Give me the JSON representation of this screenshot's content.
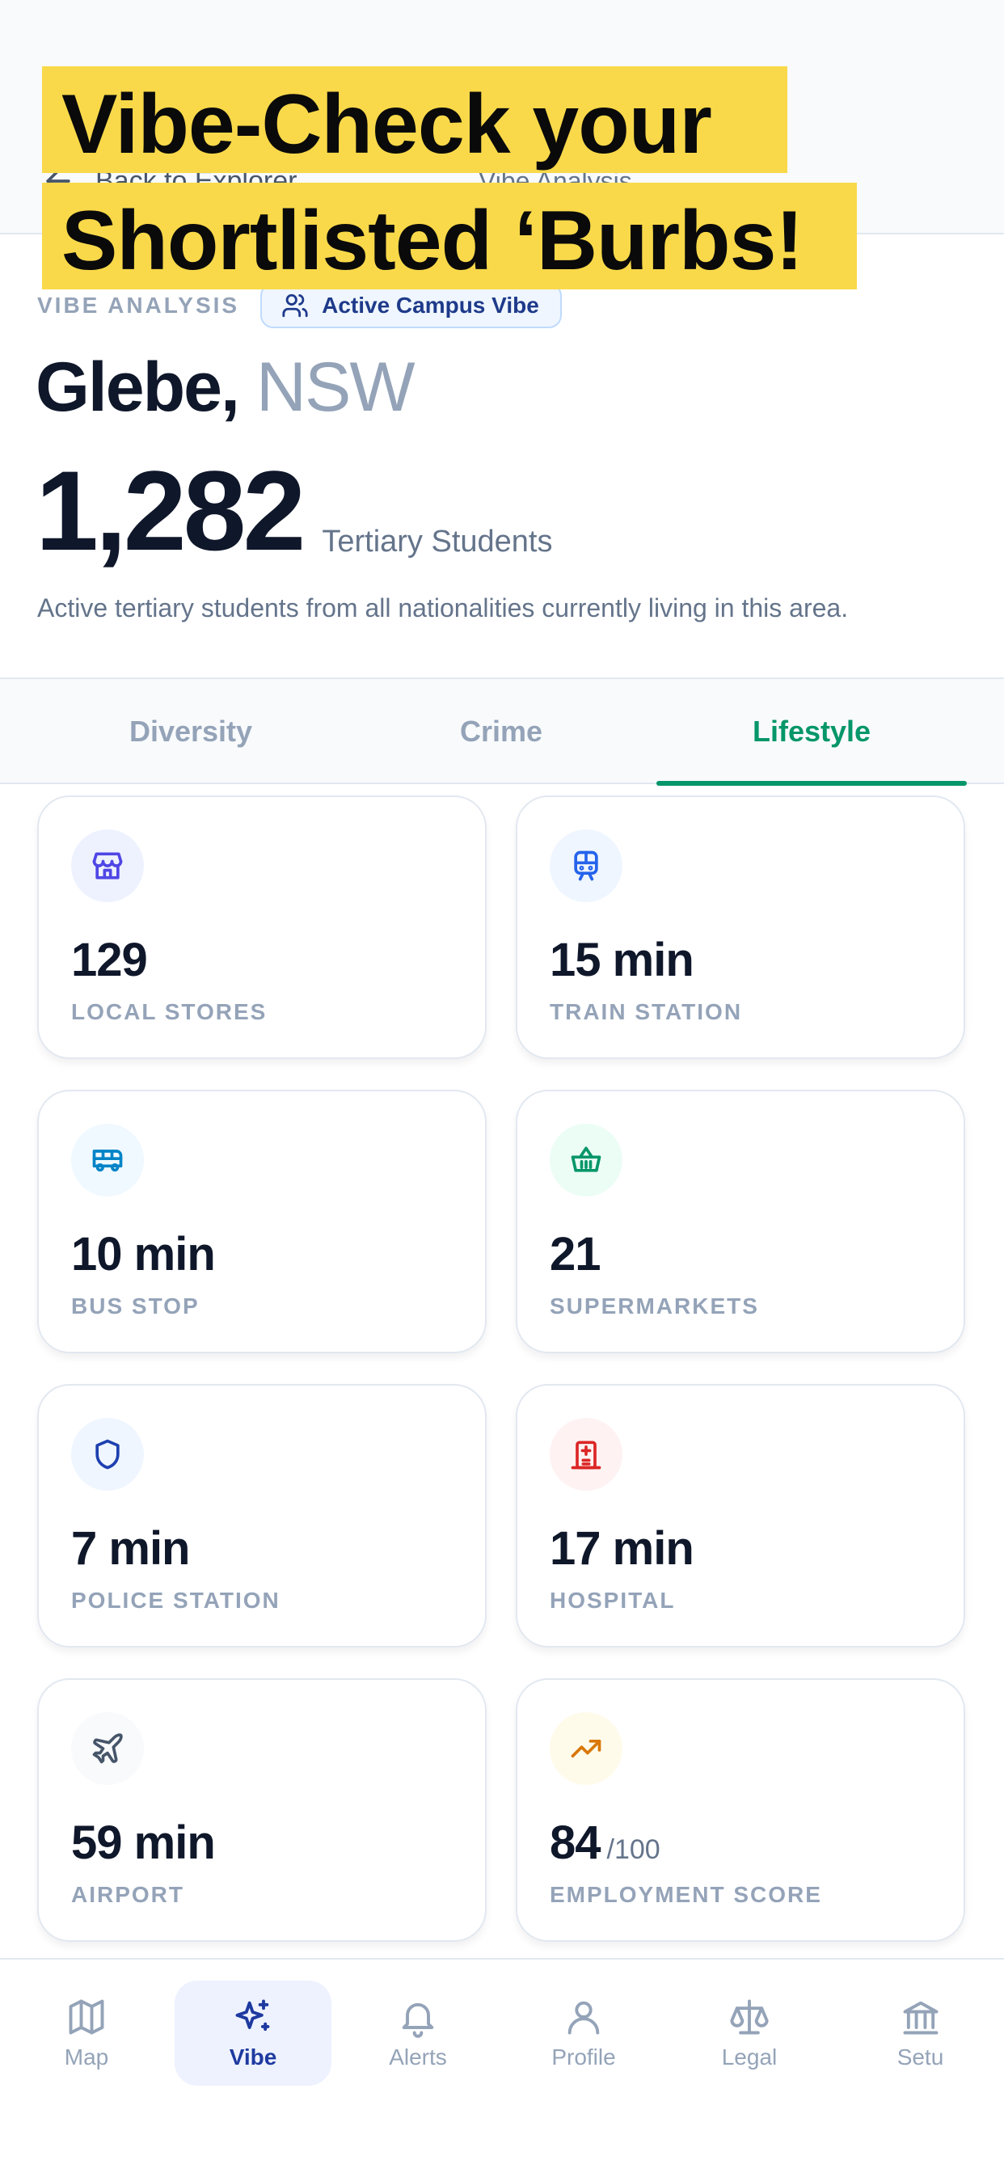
{
  "promo": {
    "line1": "Vibe-Check your",
    "line2": "Shortlisted ‘Burbs!"
  },
  "topnav": {
    "back_label": "Back to Explorer",
    "title": "Vibe Analysis"
  },
  "header": {
    "eyebrow": "VIBE ANALYSIS",
    "badge": "Active Campus Vibe",
    "suburb": "Glebe,",
    "state": "NSW",
    "student_count": "1,282",
    "student_unit": "Tertiary Students",
    "description": "Active tertiary students from all nationalities currently living in this area."
  },
  "tabs": [
    {
      "label": "Diversity",
      "active": false
    },
    {
      "label": "Crime",
      "active": false
    },
    {
      "label": "Lifestyle",
      "active": true
    }
  ],
  "cards": [
    {
      "value": "129",
      "suffix": "",
      "label": "LOCAL STORES",
      "icon": "store-icon",
      "color": "#4f46e5",
      "bg": "#eef2ff"
    },
    {
      "value": "15 min",
      "suffix": "",
      "label": "TRAIN STATION",
      "icon": "train-icon",
      "color": "#2563eb",
      "bg": "#eff6ff"
    },
    {
      "value": "10 min",
      "suffix": "",
      "label": "BUS STOP",
      "icon": "bus-icon",
      "color": "#0284c7",
      "bg": "#f0f9ff"
    },
    {
      "value": "21",
      "suffix": "",
      "label": "SUPERMARKETS",
      "icon": "basket-icon",
      "color": "#059669",
      "bg": "#ecfdf5"
    },
    {
      "value": "7 min",
      "suffix": "",
      "label": "POLICE STATION",
      "icon": "shield-icon",
      "color": "#1e40af",
      "bg": "#eff6ff"
    },
    {
      "value": "17 min",
      "suffix": "",
      "label": "HOSPITAL",
      "icon": "hospital-icon",
      "color": "#dc2626",
      "bg": "#fef2f2"
    },
    {
      "value": "59 min",
      "suffix": "",
      "label": "AIRPORT",
      "icon": "plane-icon",
      "color": "#475569",
      "bg": "#f8fafc"
    },
    {
      "value": "84",
      "suffix": "/100",
      "label": "EMPLOYMENT SCORE",
      "icon": "trending-up-icon",
      "color": "#d97706",
      "bg": "#fffbeb"
    }
  ],
  "bottom_nav": [
    {
      "label": "Map",
      "icon": "map-icon",
      "active": false
    },
    {
      "label": "Vibe",
      "icon": "sparkles-icon",
      "active": true
    },
    {
      "label": "Alerts",
      "icon": "bell-icon",
      "active": false
    },
    {
      "label": "Profile",
      "icon": "user-icon",
      "active": false
    },
    {
      "label": "Legal",
      "icon": "scale-icon",
      "active": false
    },
    {
      "label": "Setu",
      "icon": "bank-icon",
      "active": false
    }
  ],
  "colors": {
    "accent_green": "#059669",
    "promo_yellow": "#f9d94a",
    "nav_active": "#1e3aa0"
  }
}
